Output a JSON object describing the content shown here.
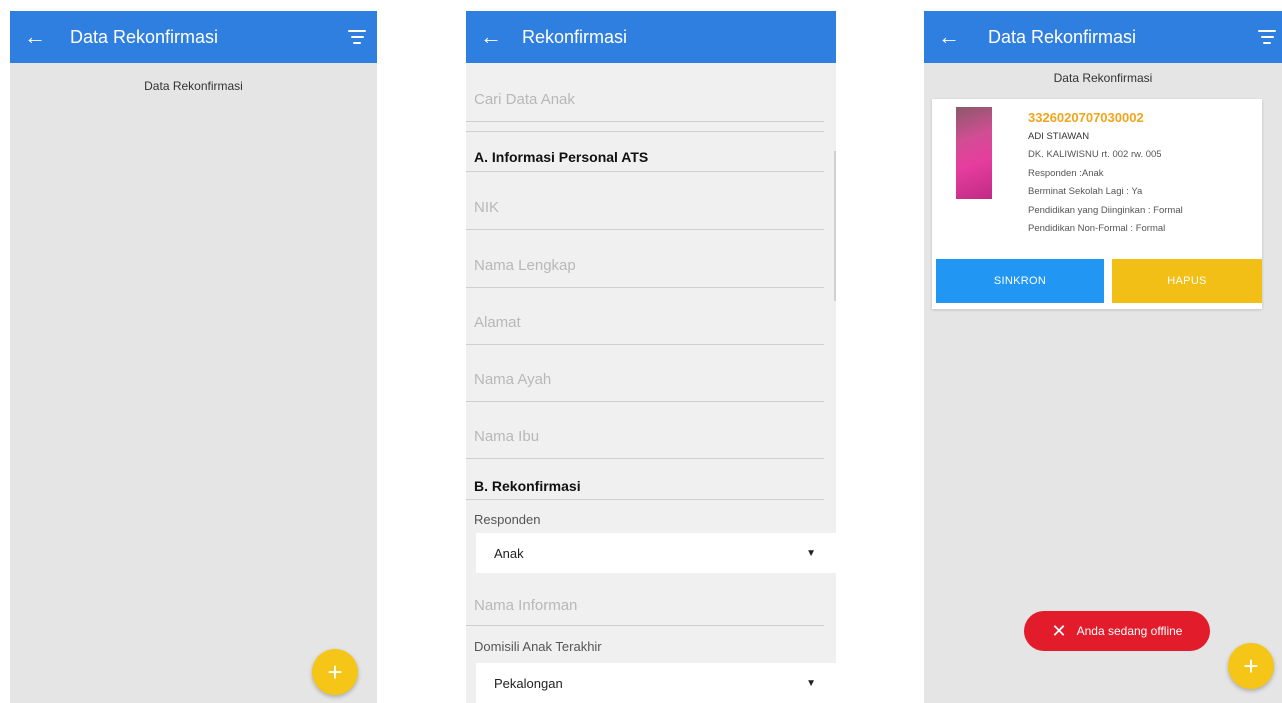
{
  "colors": {
    "app_bar": "#2f7fe0",
    "fab": "#f5c518",
    "accent_orange": "#f2a51a",
    "sync_button": "#2196f3",
    "delete_button": "#f2bf16",
    "toast": "#e21c2a"
  },
  "screen1": {
    "app_bar": {
      "back_icon": "←",
      "title": "Data Rekonfirmasi",
      "filter_icon": "filter-icon"
    },
    "subtitle": "Data Rekonfirmasi",
    "fab_icon": "+"
  },
  "screen2": {
    "app_bar": {
      "back_icon": "←",
      "title": "Rekonfirmasi"
    },
    "search_placeholder": "Cari Data Anak",
    "section_a": "A. Informasi Personal ATS",
    "fields_a": [
      "NIK",
      "Nama Lengkap",
      "Alamat",
      "Nama Ayah",
      "Nama Ibu"
    ],
    "section_b": "B. Rekonfirmasi",
    "responden_label": "Responden",
    "responden_value": "Anak",
    "nama_informan_placeholder": "Nama Informan",
    "domisili_label": "Domisili Anak Terakhir",
    "domisili_value": "Pekalongan"
  },
  "screen3": {
    "app_bar": {
      "back_icon": "←",
      "title": "Data Rekonfirmasi",
      "filter_icon": "filter-icon"
    },
    "subtitle": "Data Rekonfirmasi",
    "card": {
      "nik": "3326020707030002",
      "name": "ADI STIAWAN",
      "address": "DK. KALIWISNU rt. 002 rw. 005",
      "responden": "Responden :Anak",
      "berminat": "Berminat Sekolah Lagi : Ya",
      "pendidikan": "Pendidikan yang Diinginkan : Formal",
      "non_formal": "Pendidikan Non-Formal : Formal",
      "sync_label": "SINKRON",
      "delete_label": "HAPUS"
    },
    "toast": {
      "icon": "✕",
      "text": "Anda sedang offline"
    },
    "fab_icon": "+"
  }
}
